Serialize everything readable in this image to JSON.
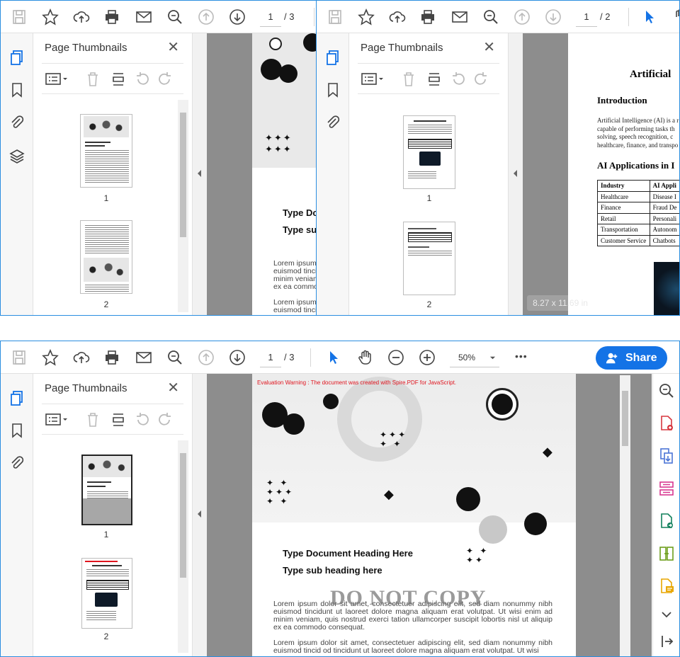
{
  "win1": {
    "page_current": "1",
    "page_total": "/ 3",
    "panel_title": "Page Thumbnails",
    "close": "✕",
    "thumbs": [
      "1",
      "2"
    ]
  },
  "win2": {
    "page_current": "1",
    "page_total": "/ 2",
    "panel_title": "Page Thumbnails",
    "close": "✕",
    "thumbs": [
      "1",
      "2"
    ],
    "doc": {
      "title": "Artificial",
      "intro_heading": "Introduction",
      "intro_lines": [
        "Artificial Intelligence (AI) is a r",
        "capable of performing tasks th",
        "solving, speech recognition, c",
        "healthcare, finance, and transpo"
      ],
      "apps_heading": "AI Applications in I",
      "table": {
        "headers": [
          "Industry",
          "AI Appli"
        ],
        "rows": [
          [
            "Healthcare",
            "Disease I"
          ],
          [
            "Finance",
            "Fraud De"
          ],
          [
            "Retail",
            "Personali"
          ],
          [
            "Transportation",
            "Autonom"
          ],
          [
            "Customer Service",
            "Chatbots"
          ]
        ]
      }
    },
    "size_tooltip": "8.27 x 11.69 in"
  },
  "win3": {
    "page_current": "1",
    "page_total": "/ 3",
    "zoom": "50%",
    "more": "•••",
    "share_label": "Share",
    "panel_title": "Page Thumbnails",
    "close": "✕",
    "thumbs": [
      "1",
      "2"
    ],
    "doc": {
      "eval_warning": "Evaluation Warning : The document was created with Spire.PDF for JavaScript.",
      "heading": "Type Document Heading Here",
      "subheading": "Type sub heading here",
      "watermark": "DO NOT COPY",
      "para1": "Lorem ipsum dolor sit amet, consectetuer adipiscing elit, sed diam nonummy nibh euismod tincidunt ut laoreet dolore magna aliquam erat volutpat. Ut wisi enim ad minim veniam, quis nostrud exerci tation ullamcorper suscipit lobortis nisl ut aliquip ex ea commodo consequat.",
      "para2": "Lorem ipsum dolor sit amet, consectetuer adipiscing elit, sed diam nonummy nibh euismod tincid od tincidunt ut laoreet dolore magna aliquam erat volutpat. Ut wisi"
    }
  },
  "win1_doc": {
    "heading": "Type Do",
    "subheading": "Type su",
    "lines1": [
      "Lorem ipsum",
      "euismod tinci",
      "minim veniam",
      "ex ea commo"
    ],
    "lines2": [
      "Lorem ipsum",
      "euismod tinci"
    ]
  },
  "colors": {
    "accent": "#1473e6",
    "gray_area": "#8d8d8d",
    "window_border": "#2b8ee0",
    "eval_red": "#e0141e"
  }
}
